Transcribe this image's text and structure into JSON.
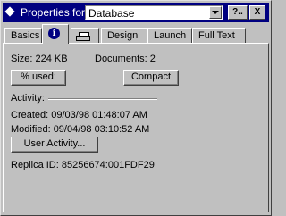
{
  "window": {
    "title": "Properties for:",
    "object_type": "Database",
    "help_label": "?..",
    "close_label": "X"
  },
  "tabs": [
    {
      "label": "Basics"
    },
    {
      "label": "i",
      "icon": "info-icon"
    },
    {
      "label": "",
      "icon": "printer-icon"
    },
    {
      "label": "Design"
    },
    {
      "label": "Launch"
    },
    {
      "label": "Full Text"
    }
  ],
  "info": {
    "size": "Size: 224 KB",
    "documents": "Documents:  2",
    "percent_used_label": "% used:",
    "compact_label": "Compact",
    "activity_label": "Activity:",
    "created": "Created:  09/03/98 01:48:07 AM",
    "modified": "Modified: 09/04/98 03:10:52 AM",
    "user_activity_label": "User Activity...",
    "replica_id": "Replica ID:  85256674:001FDF29"
  }
}
